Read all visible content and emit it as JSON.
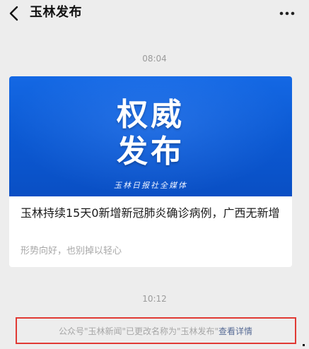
{
  "header": {
    "title": "玉林发布",
    "back_icon": "chevron-left-icon",
    "more_icon": "more-horizontal-icon"
  },
  "messages": {
    "timestamp_1": "08:04",
    "article": {
      "banner_line1": "权威",
      "banner_line2": "发布",
      "banner_sub": "玉林日报社全媒体",
      "title": "玉林持续15天0新增新冠肺炎确诊病例，广西无新增",
      "summary": "形势向好，也别掉以轻心"
    },
    "timestamp_2": "10:12",
    "notice": {
      "text": "公众号\"玉林新闻\"已更改名称为\"玉林发布\"",
      "link": "查看详情"
    }
  },
  "colors": {
    "background": "#ededed",
    "banner_blue": "#0b58d1",
    "link_blue": "#576b95",
    "highlight_red": "#e03a34"
  }
}
